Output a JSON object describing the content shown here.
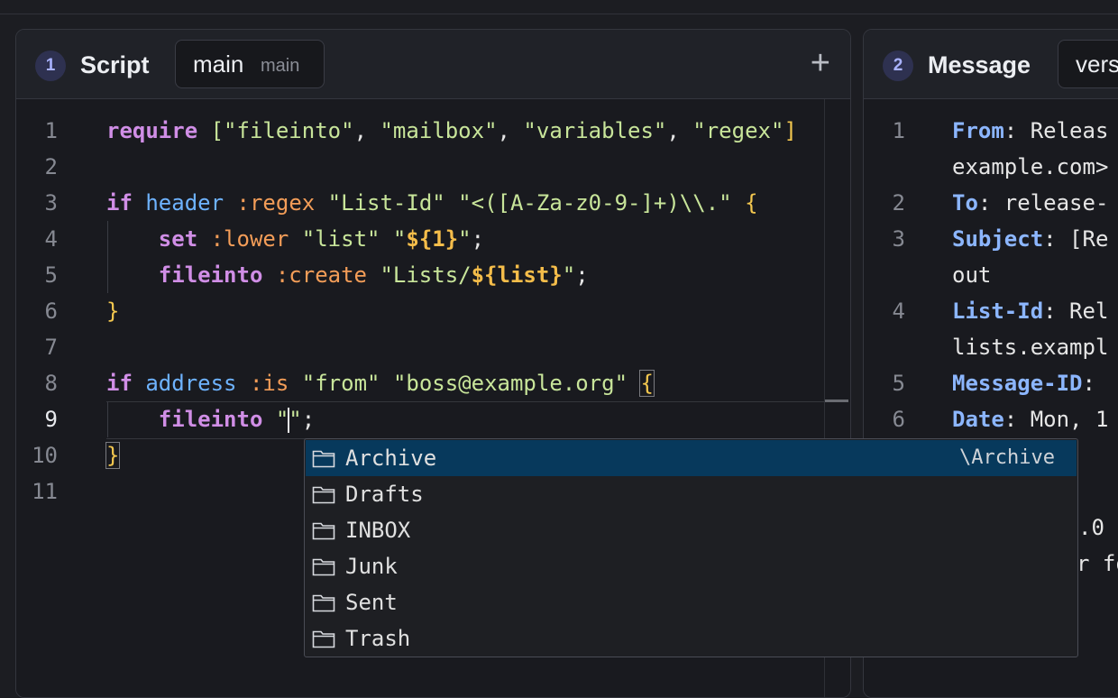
{
  "script_panel": {
    "number": "1",
    "title": "Script",
    "tab_name": "main",
    "tab_sub": "main",
    "add_label": "+"
  },
  "message_panel": {
    "number": "2",
    "title": "Message",
    "tab_name": "vers"
  },
  "editor": {
    "line_numbers": [
      "1",
      "2",
      "3",
      "4",
      "5",
      "6",
      "7",
      "8",
      "9",
      "10",
      "11"
    ],
    "active_line": "9"
  },
  "message_lines": {
    "line_numbers": [
      "1",
      "2",
      "3",
      "4",
      "5",
      "6"
    ],
    "rows": [
      {
        "key": "From",
        "value": ": Releas"
      },
      {
        "cont": "example.com>"
      },
      {
        "key": "To",
        "value": ": release-"
      },
      {
        "key": "Subject",
        "value": ": [Re"
      },
      {
        "cont": "out"
      },
      {
        "key": "List-Id",
        "value": ": Rel"
      },
      {
        "cont": "lists.exampl"
      },
      {
        "key": "Message-ID",
        "value": ":"
      },
      {
        "key": "Date",
        "value": ": Mon, 1"
      },
      {
        "cont": ".0"
      },
      {
        "cont": "r fo"
      }
    ]
  },
  "suggestions": [
    {
      "label": "Archive",
      "detail": "\\Archive",
      "selected": true
    },
    {
      "label": "Drafts",
      "detail": ""
    },
    {
      "label": "INBOX",
      "detail": ""
    },
    {
      "label": "Junk",
      "detail": ""
    },
    {
      "label": "Sent",
      "detail": ""
    },
    {
      "label": "Trash",
      "detail": ""
    }
  ],
  "colors": {
    "keyword": "#d08ee6",
    "string": "#c8e59a",
    "test": "#6eb3ff",
    "tag": "#f39d58",
    "variable": "#f5bd4a",
    "selection": "#07395c"
  }
}
